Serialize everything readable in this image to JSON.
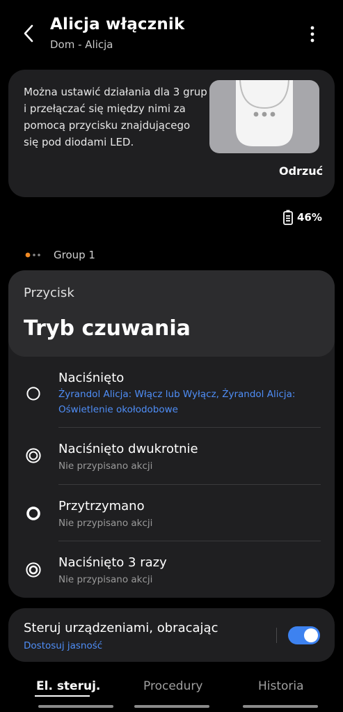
{
  "header": {
    "title": "Alicja włącznik",
    "subtitle": "Dom - Alicja"
  },
  "info": {
    "text": "Można ustawić działania dla 3 grup i przełączać się między nimi za pomocą przycisku znajdującego się pod diodami LED.",
    "dismiss_label": "Odrzuć"
  },
  "battery": {
    "percent": "46%"
  },
  "group": {
    "label": "Group 1",
    "active_dot_color": "#f08a24"
  },
  "button": {
    "label": "Przycisk",
    "mode": "Tryb czuwania",
    "actions": [
      {
        "name": "Naciśnięto",
        "detail": "Żyrandol Alicja: Włącz lub Wyłącz, Żyrandol Alicja: Oświetlenie okołodobowe",
        "icon": "single-press-icon"
      },
      {
        "name": "Naciśnięto dwukrotnie",
        "detail": "Nie przypisano akcji",
        "icon": "double-press-icon"
      },
      {
        "name": "Przytrzymano",
        "detail": "Nie przypisano akcji",
        "icon": "hold-icon"
      },
      {
        "name": "Naciśnięto 3 razy",
        "detail": "Nie przypisano akcji",
        "icon": "triple-press-icon"
      }
    ]
  },
  "rotate": {
    "title": "Steruj urządzeniami, obracając",
    "link": "Dostosuj jasność",
    "enabled": true,
    "toggle_color": "#3d82f0"
  },
  "tabs": [
    {
      "label": "El. steruj.",
      "active": true
    },
    {
      "label": "Procedury",
      "active": false
    },
    {
      "label": "Historia",
      "active": false
    }
  ],
  "colors": {
    "accent_blue": "#4f8ef7",
    "card_bg": "#1f1f21"
  }
}
